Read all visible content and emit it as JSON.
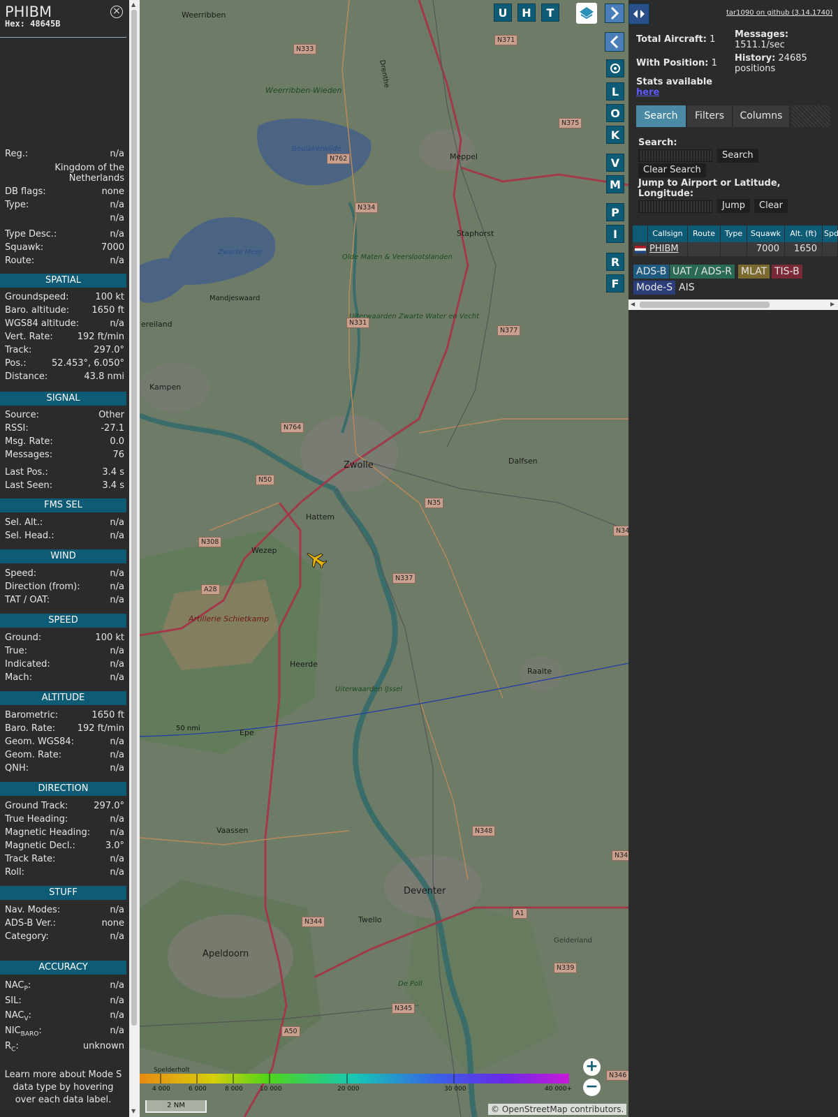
{
  "info": {
    "callsign": "PHIBM",
    "hex": "Hex:  48645B",
    "close_icon": "close-icon",
    "rows_top": [
      {
        "label": "Reg.:",
        "value": "n/a"
      },
      {
        "label": "DB flags:",
        "value": "none"
      },
      {
        "label": "Type:",
        "value": "n/a"
      },
      {
        "label": "",
        "value": "n/a"
      },
      {
        "label": "Type Desc.:",
        "value": "n/a"
      },
      {
        "label": "Squawk:",
        "value": "7000"
      },
      {
        "label": "Route:",
        "value": "n/a"
      }
    ],
    "country": "Kingdom of the Netherlands",
    "sections": [
      {
        "title": "SPATIAL",
        "rows": [
          {
            "label": "Groundspeed:",
            "value": "100 kt"
          },
          {
            "label": "Baro. altitude:",
            "value": "1650 ft"
          },
          {
            "label": "WGS84 altitude:",
            "value": "n/a"
          },
          {
            "label": "Vert. Rate:",
            "value": "192 ft/min"
          },
          {
            "label": "Track:",
            "value": "297.0°"
          },
          {
            "label": "Pos.:",
            "value": "52.453°, 6.050°"
          },
          {
            "label": "Distance:",
            "value": "43.8 nmi"
          }
        ]
      },
      {
        "title": "SIGNAL",
        "rows": [
          {
            "label": "Source:",
            "value": "Other"
          },
          {
            "label": "RSSI:",
            "value": "-27.1"
          },
          {
            "label": "Msg. Rate:",
            "value": "0.0"
          },
          {
            "label": "Messages:",
            "value": "76"
          },
          {
            "label": "Last Pos.:",
            "value": "3.4 s"
          },
          {
            "label": "Last Seen:",
            "value": "3.4 s"
          }
        ]
      },
      {
        "title": "FMS SEL",
        "rows": [
          {
            "label": "Sel. Alt.:",
            "value": "n/a"
          },
          {
            "label": "Sel. Head.:",
            "value": "n/a"
          }
        ]
      },
      {
        "title": "WIND",
        "rows": [
          {
            "label": "Speed:",
            "value": "n/a"
          },
          {
            "label": "Direction (from):",
            "value": "n/a"
          },
          {
            "label": "TAT / OAT:",
            "value": "n/a"
          }
        ]
      },
      {
        "title": "SPEED",
        "rows": [
          {
            "label": "Ground:",
            "value": "100 kt"
          },
          {
            "label": "True:",
            "value": "n/a"
          },
          {
            "label": "Indicated:",
            "value": "n/a"
          },
          {
            "label": "Mach:",
            "value": "n/a"
          }
        ]
      },
      {
        "title": "ALTITUDE",
        "rows": [
          {
            "label": "Barometric:",
            "value": "1650 ft"
          },
          {
            "label": "Baro. Rate:",
            "value": "192 ft/min"
          },
          {
            "label": "Geom. WGS84:",
            "value": "n/a"
          },
          {
            "label": "Geom. Rate:",
            "value": "n/a"
          },
          {
            "label": "QNH:",
            "value": "n/a"
          }
        ]
      },
      {
        "title": "DIRECTION",
        "rows": [
          {
            "label": "Ground Track:",
            "value": "297.0°"
          },
          {
            "label": "True Heading:",
            "value": "n/a"
          },
          {
            "label": "Magnetic Heading:",
            "value": "n/a"
          },
          {
            "label": "Magnetic Decl.:",
            "value": "3.0°"
          },
          {
            "label": "Track Rate:",
            "value": "n/a"
          },
          {
            "label": "Roll:",
            "value": "n/a"
          }
        ]
      },
      {
        "title": "STUFF",
        "rows": [
          {
            "label": "Nav. Modes:",
            "value": "n/a"
          },
          {
            "label": "ADS-B Ver.:",
            "value": "none"
          },
          {
            "label": "Category:",
            "value": "n/a"
          }
        ]
      }
    ],
    "accuracy_title": "ACCURACY",
    "accuracy": {
      "nacp_value": "n/a",
      "sil_label": "SIL:",
      "sil_value": "n/a",
      "nacv_value": "n/a",
      "nicbaro_value": "n/a",
      "rc_value": "unknown"
    },
    "footer_note": "Learn more about Mode S data type by hovering over each data label."
  },
  "map": {
    "buttons_top": [
      "U",
      "H",
      "T"
    ],
    "side_buttons": [
      "L",
      "O",
      "K",
      "V",
      "M",
      "P",
      "I",
      "R",
      "F"
    ],
    "icons": {
      "layers": "layers-icon",
      "expand": "chevron-right-icon",
      "collapse": "chevron-left-icon",
      "settings": "gear-icon",
      "split": "split-arrows-icon",
      "zoom_in": "plus-icon",
      "zoom_out": "minus-icon",
      "aircraft": "airplane-icon"
    },
    "places": [
      "Weerribben",
      "Weerribben-Wieden",
      "Beulakerwijde",
      "Meppel",
      "Staphorst",
      "Zwarte Meer",
      "Olde Maten & Veerslootslanden",
      "Mandjeswaard",
      "Uiterwaarden Zwarte Water en Vecht",
      "Kampen",
      "Zwolle",
      "Dalfsen",
      "Hattem",
      "Wezep",
      "Artillerie Schietkamp",
      "Heerde",
      "Raalte",
      "Epe",
      "Uiterwaarden IJssel",
      "Vaassen",
      "Deventer",
      "Twello",
      "Apeldoorn",
      "De Poll",
      "Gelderland",
      "Spelderholt",
      "Drenthe",
      "ereiland"
    ],
    "roads": [
      "N371",
      "N333",
      "N375",
      "N762",
      "N334",
      "N331",
      "N377",
      "N764",
      "N50",
      "N35",
      "N308",
      "N337",
      "A28",
      "N348",
      "N344",
      "A1",
      "N339",
      "N345",
      "A50",
      "N346",
      "N34",
      "N34"
    ],
    "range_ring_label": "50 nmi",
    "altitude_ticks": [
      "4 000",
      "6 000",
      "8 000",
      "10 000",
      "20 000",
      "30 000",
      "40 000+"
    ],
    "scale_label": "2 NM",
    "credit_prefix": "© ",
    "credit_link": "OpenStreetMap",
    "credit_suffix": " contributors."
  },
  "sidebar": {
    "github_link": "tar1090 on github (3.14.1740)",
    "total_aircraft_label": "Total Aircraft:",
    "total_aircraft": "1",
    "with_position_label": "With Position:",
    "with_position": "1",
    "messages_label": "Messages:",
    "messages_rate": "1511.1/sec",
    "history_label": "History:",
    "history_value": "24685",
    "history_unit": "positions",
    "stats_text": "Stats available",
    "stats_link": "here",
    "tabs": [
      "Search",
      "Filters",
      "Columns"
    ],
    "search_label": "Search:",
    "search_button": "Search",
    "clear_search_button": "Clear Search",
    "jump_label": "Jump to Airport or Latitude, Longitude:",
    "jump_button": "Jump",
    "clear_button": "Clear",
    "table_headers": [
      "",
      "Callsign",
      "Route",
      "Type",
      "Squawk",
      "Alt. (ft)",
      "Spd."
    ],
    "table_rows": [
      {
        "flag": "netherlands-flag-icon",
        "callsign": "PHIBM",
        "route": "",
        "type": "",
        "squawk": "7000",
        "alt": "1650",
        "spd": ""
      }
    ],
    "legend": [
      {
        "label": "ADS-B",
        "color": "#1f5a80"
      },
      {
        "label": "UAT / ADS-R",
        "color": "#2a6a52"
      },
      {
        "label": "MLAT",
        "color": "#7a6a30"
      },
      {
        "label": "TIS-B",
        "color": "#7a2a36"
      },
      {
        "label": "Mode-S",
        "color": "#2b3e7a"
      },
      {
        "label": "AIS",
        "color": "#2b2b2b"
      }
    ]
  }
}
